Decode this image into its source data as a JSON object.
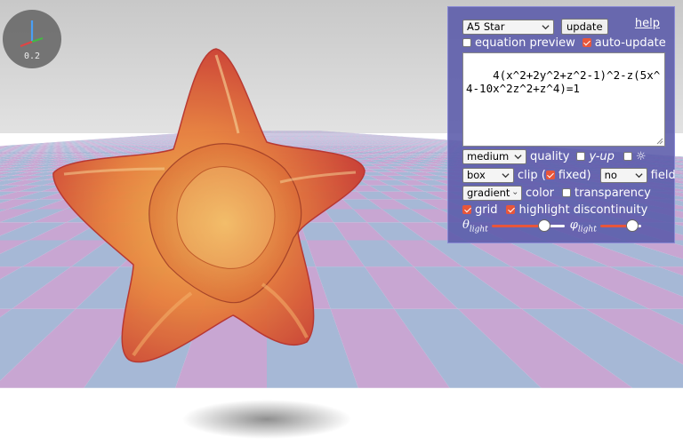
{
  "scene": {
    "sky_top": "#c8c8c8",
    "sky_bottom": "#e2e2e2",
    "floor_pink": "#c8a6d2",
    "floor_blue": "#a6b8d6",
    "surface_color": "#e9813b",
    "surface_highlight": "#d0232a"
  },
  "gizmo": {
    "value": "0.2",
    "axis_x_color": "#e04444",
    "axis_y_color": "#4a9ff5",
    "axis_z_color": "#44b844"
  },
  "panel": {
    "preset": {
      "selected": "A5 Star"
    },
    "update_label": "update",
    "help_label": "help",
    "equation_preview": {
      "label": "equation preview",
      "checked": false
    },
    "auto_update": {
      "label": "auto-update",
      "checked": true
    },
    "equation": "4(x^2+2y^2+z^2-1)^2-z(5x^4-10x^2z^2+z^4)=1",
    "quality": {
      "selected": "medium",
      "label": "quality"
    },
    "y_up": {
      "label": "y-up",
      "checked": false
    },
    "light_toggle": {
      "label": "☼",
      "checked": false
    },
    "clip": {
      "selected": "box",
      "label_open": "clip (",
      "fixed_label": "fixed)",
      "fixed_checked": true
    },
    "field": {
      "selected": "no",
      "label": "field"
    },
    "color": {
      "selected": "gradient",
      "label": "color"
    },
    "transparency": {
      "label": "transparency",
      "checked": false
    },
    "grid": {
      "label": "grid",
      "checked": true
    },
    "highlight": {
      "label": "highlight discontinuity",
      "checked": true
    },
    "theta_light": {
      "symbol": "θ",
      "sub": "light",
      "value": 0.72
    },
    "phi_light": {
      "symbol": "φ",
      "sub": "light",
      "value": 0.78
    }
  }
}
